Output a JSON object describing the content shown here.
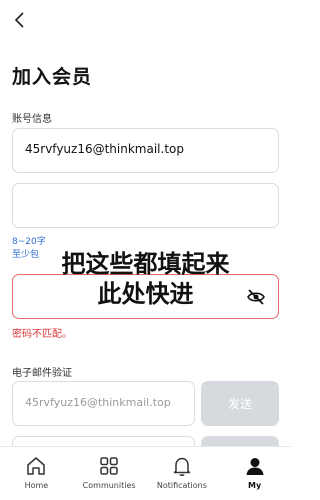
{
  "header": {
    "title": "加入会员"
  },
  "account": {
    "section_label": "账号信息",
    "email_value": "45rvfyuz16@thinkmail.top",
    "password_value": "",
    "hint_line1": "8~20字",
    "hint_line2": "至少包",
    "confirm_password_value": "",
    "error_text": "密码不匹配。"
  },
  "overlay": {
    "line1": "把这些都填起来",
    "line2": "此处快进"
  },
  "email_verify": {
    "section_label": "电子邮件验证",
    "email_value": "45rvfyuz16@thinkmail.top",
    "send_label": "发送"
  },
  "tabbar": {
    "tabs": [
      {
        "label": "Home",
        "icon": "home-icon"
      },
      {
        "label": "Communities",
        "icon": "grid-icon"
      },
      {
        "label": "Notifications",
        "icon": "bell-icon"
      },
      {
        "label": "My",
        "icon": "person-icon",
        "active": true
      }
    ]
  },
  "colors": {
    "error": "#d93a3a",
    "hint": "#2f6fd6",
    "disabled_button": "#d6d9de"
  }
}
